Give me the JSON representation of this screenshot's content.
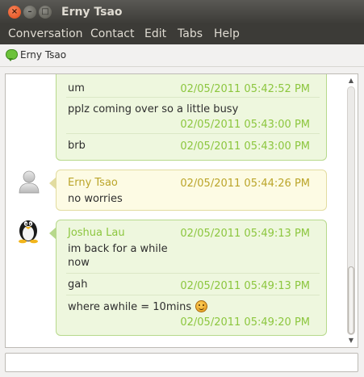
{
  "window": {
    "title": "Erny Tsao"
  },
  "menu": {
    "conversation": "Conversation",
    "contact": "Contact",
    "edit": "Edit",
    "tabs": "Tabs",
    "help": "Help"
  },
  "tab": {
    "label": "Erny Tsao",
    "icon": "chat-bubble-icon"
  },
  "messages": {
    "block1": [
      {
        "text": "um",
        "time": "02/05/2011 05:42:52 PM"
      },
      {
        "text": "pplz coming over so a little busy",
        "time": "02/05/2011 05:43:00 PM"
      },
      {
        "text": "brb",
        "time": "02/05/2011 05:43:00 PM"
      }
    ],
    "block2": {
      "sender": "Erny Tsao",
      "time": "02/05/2011 05:44:26 PM",
      "text": "no worries"
    },
    "block3": {
      "sender": "Joshua Lau",
      "items": [
        {
          "text_line1": "im back for a while",
          "text_line2": "now",
          "time": "02/05/2011 05:49:13 PM"
        },
        {
          "text": "gah",
          "time": "02/05/2011 05:49:13 PM"
        },
        {
          "text": "where awhile = 10mins",
          "time": "02/05/2011 05:49:20 PM",
          "emoji": "smiley-icon"
        }
      ]
    }
  },
  "colors": {
    "outgoing_bubble": "#eef7de",
    "incoming_bubble": "#fdfbe4",
    "outgoing_text_accent": "#8cc63e",
    "incoming_text_accent": "#bba52a",
    "titlebar": "#3c3b37"
  }
}
